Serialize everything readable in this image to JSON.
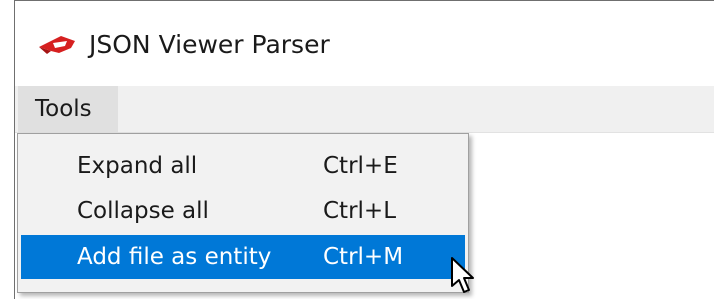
{
  "app": {
    "title": "JSON Viewer Parser",
    "logo_icon": "red-arrow-logo-icon",
    "logo_color": "#d62020"
  },
  "menubar": {
    "items": [
      {
        "label": "Tools"
      }
    ]
  },
  "dropdown": {
    "items": [
      {
        "label": "Expand all",
        "shortcut": "Ctrl+E",
        "highlighted": false
      },
      {
        "label": "Collapse all",
        "shortcut": "Ctrl+L",
        "highlighted": false
      },
      {
        "label": "Add file as entity",
        "shortcut": "Ctrl+M",
        "highlighted": true
      }
    ]
  },
  "colors": {
    "highlight": "#0078d7",
    "menubar": "#f0f0f0",
    "menu_background": "#f2f2f2"
  }
}
